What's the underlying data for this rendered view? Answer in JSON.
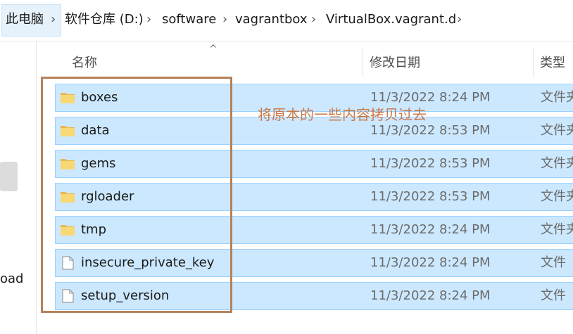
{
  "breadcrumb": {
    "items": [
      "此电脑",
      "软件仓库 (D:)",
      "software",
      "vagrantbox",
      "VirtualBox.vagrant.d"
    ]
  },
  "nav": {
    "partial_label": "oad"
  },
  "columns": {
    "name": "名称",
    "date": "修改日期",
    "type": "类型"
  },
  "files": [
    {
      "name": "boxes",
      "date": "11/3/2022 8:24 PM",
      "type": "文件夹",
      "kind": "folder"
    },
    {
      "name": "data",
      "date": "11/3/2022 8:53 PM",
      "type": "文件夹",
      "kind": "folder"
    },
    {
      "name": "gems",
      "date": "11/3/2022 8:53 PM",
      "type": "文件夹",
      "kind": "folder"
    },
    {
      "name": "rgloader",
      "date": "11/3/2022 8:53 PM",
      "type": "文件夹",
      "kind": "folder"
    },
    {
      "name": "tmp",
      "date": "11/3/2022 8:24 PM",
      "type": "文件夹",
      "kind": "folder"
    },
    {
      "name": "insecure_private_key",
      "date": "11/3/2022 8:24 PM",
      "type": "文件",
      "kind": "file"
    },
    {
      "name": "setup_version",
      "date": "11/3/2022 8:24 PM",
      "type": "文件",
      "kind": "file"
    }
  ],
  "annotation": {
    "text": "将原本的一些内容拷贝过去",
    "color": "#c8784a"
  },
  "colors": {
    "selection_fill": "#cce8ff",
    "selection_border": "#99d1ff",
    "folder": "#f8d775"
  }
}
